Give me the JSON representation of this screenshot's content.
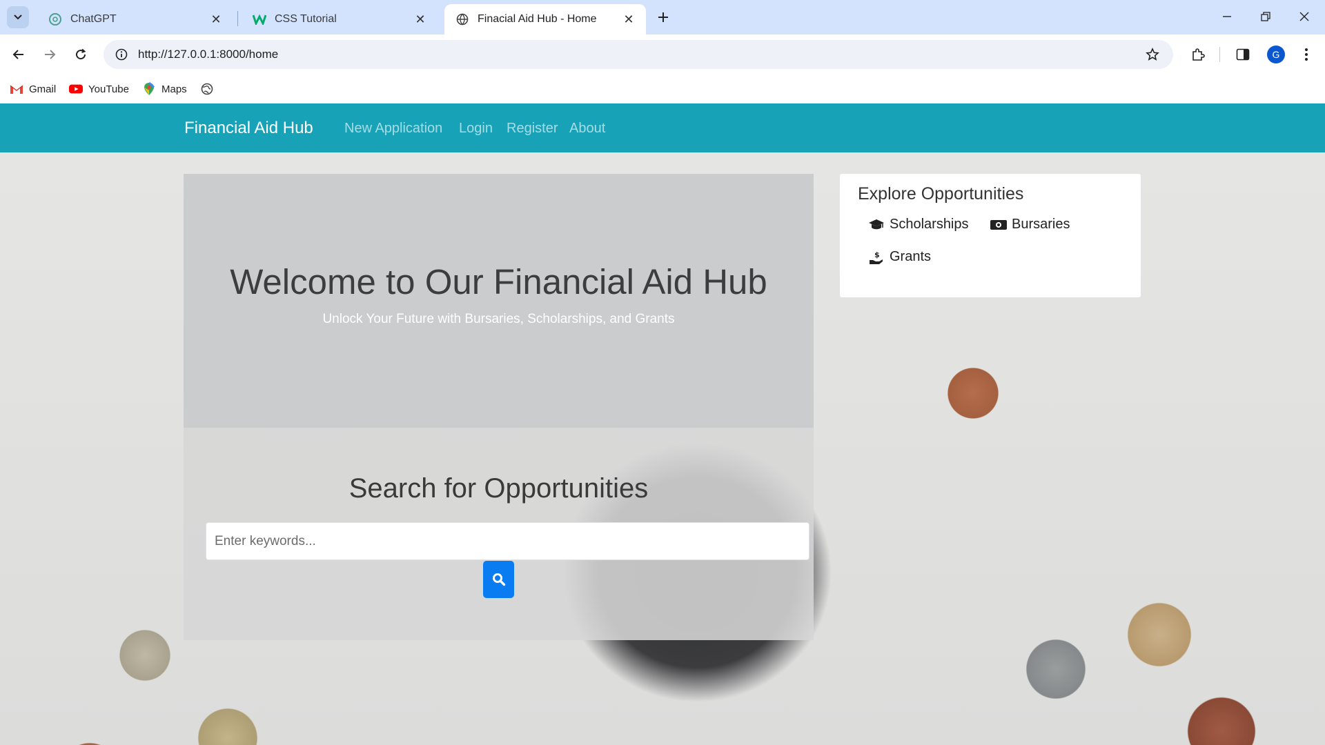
{
  "browser": {
    "tabs": [
      {
        "title": "ChatGPT",
        "icon": "chatgpt-icon",
        "active": false
      },
      {
        "title": "CSS Tutorial",
        "icon": "w3schools-icon",
        "active": false
      },
      {
        "title": "Finacial Aid Hub - Home",
        "icon": "globe-icon",
        "active": true
      }
    ],
    "url": "http://127.0.0.1:8000/home",
    "profile_initial": "G",
    "bookmarks": [
      {
        "label": "Gmail",
        "icon": "gmail-icon"
      },
      {
        "label": "YouTube",
        "icon": "youtube-icon"
      },
      {
        "label": "Maps",
        "icon": "maps-icon"
      },
      {
        "label": "",
        "icon": "globe-icon"
      }
    ]
  },
  "site": {
    "brand": "Financial Aid Hub",
    "nav": [
      "New Application",
      "Login",
      "Register",
      "About"
    ],
    "accent_color": "#17a2b8"
  },
  "hero": {
    "title": "Welcome to Our Financial Aid Hub",
    "subtitle": "Unlock Your Future with Bursaries, Scholarships, and Grants"
  },
  "search": {
    "title": "Search for Opportunities",
    "placeholder": "Enter keywords...",
    "button_color": "#0a7cf1"
  },
  "explore": {
    "title": "Explore Opportunities",
    "items": [
      {
        "label": "Scholarships",
        "icon": "graduation-cap-icon"
      },
      {
        "label": "Bursaries",
        "icon": "money-bill-icon"
      },
      {
        "label": "Grants",
        "icon": "hand-holding-dollar-icon"
      }
    ]
  }
}
